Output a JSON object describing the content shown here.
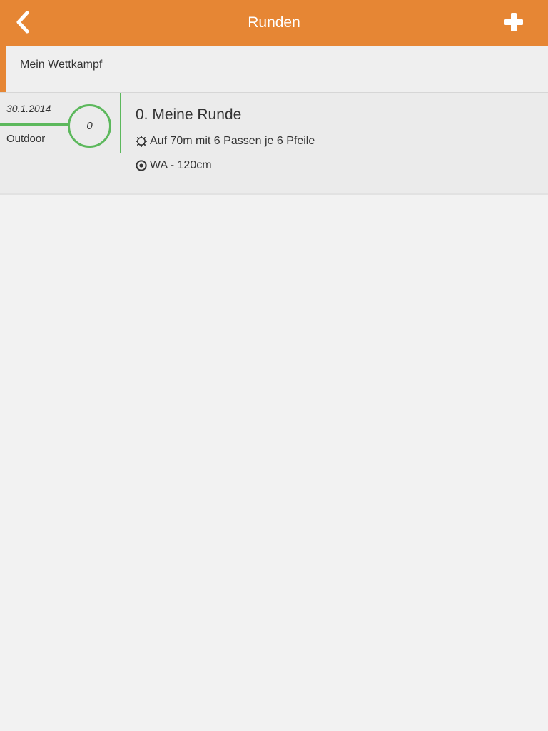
{
  "navbar": {
    "title": "Runden",
    "back_icon": "chevron-left-icon",
    "add_icon": "plus-icon",
    "color": "#e68634"
  },
  "section": {
    "title": "Mein Wettkampf",
    "accent_color": "#e68634"
  },
  "rounds": [
    {
      "date": "30.1.2014",
      "type": "Outdoor",
      "score": "0",
      "title": "0. Meine Runde",
      "distance_icon": "gear-icon",
      "distance_text": "Auf 70m mit 6 Passen je 6 Pfeile",
      "target_icon": "target-icon",
      "target_text": "WA - 120cm",
      "status_color": "#5cb85c"
    }
  ]
}
